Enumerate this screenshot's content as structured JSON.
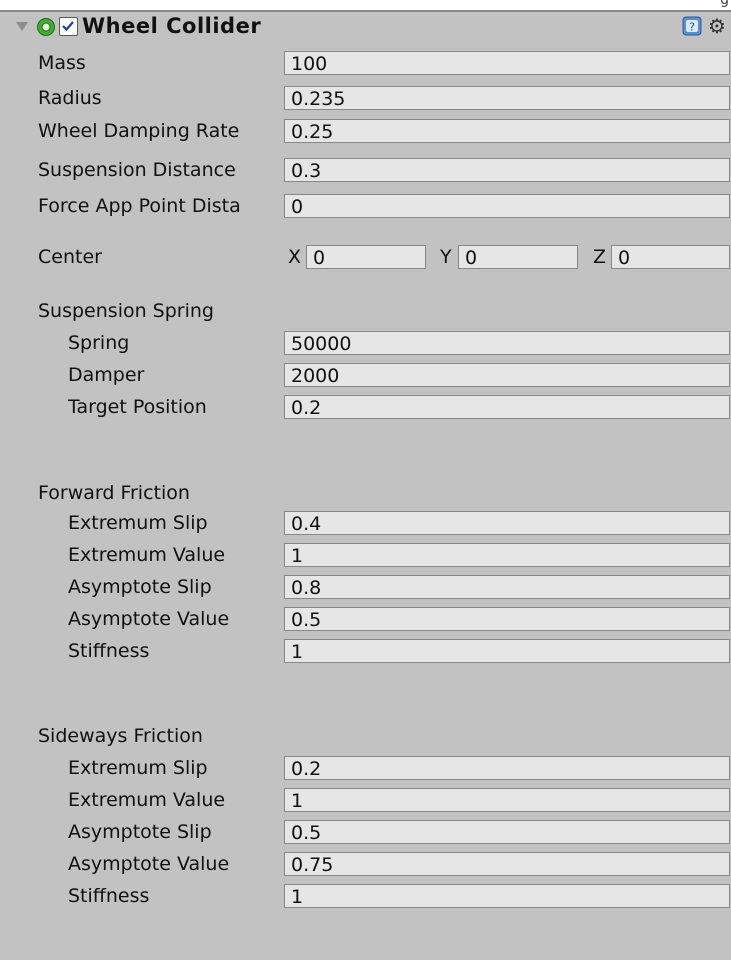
{
  "component": {
    "title": "Wheel Collider",
    "enabled": true,
    "icons": {
      "foldout": "triangle-down-icon",
      "component": "wheel-collider-icon",
      "help": "help-icon",
      "settings": "gear-icon"
    }
  },
  "properties": [
    {
      "label": "Mass",
      "value": "100"
    },
    {
      "label": "Radius",
      "value": "0.235"
    },
    {
      "label": "Wheel Damping Rate",
      "value": "0.25"
    },
    {
      "label": "Suspension Distance",
      "value": "0.3"
    },
    {
      "label": "Force App Point Dista",
      "value": "0"
    }
  ],
  "center": {
    "label": "Center",
    "x_label": "X",
    "x": "0",
    "y_label": "Y",
    "y": "0",
    "z_label": "Z",
    "z": "0"
  },
  "suspension_spring": {
    "label": "Suspension Spring",
    "fields": [
      {
        "label": "Spring",
        "value": "50000"
      },
      {
        "label": "Damper",
        "value": "2000"
      },
      {
        "label": "Target Position",
        "value": "0.2"
      }
    ]
  },
  "forward_friction": {
    "label": "Forward Friction",
    "fields": [
      {
        "label": "Extremum Slip",
        "value": "0.4"
      },
      {
        "label": "Extremum Value",
        "value": "1"
      },
      {
        "label": "Asymptote Slip",
        "value": "0.8"
      },
      {
        "label": "Asymptote Value",
        "value": "0.5"
      },
      {
        "label": "Stiffness",
        "value": "1"
      }
    ]
  },
  "sideways_friction": {
    "label": "Sideways Friction",
    "fields": [
      {
        "label": "Extremum Slip",
        "value": "0.2"
      },
      {
        "label": "Extremum Value",
        "value": "1"
      },
      {
        "label": "Asymptote Slip",
        "value": "0.5"
      },
      {
        "label": "Asymptote Value",
        "value": "0.75"
      },
      {
        "label": "Stiffness",
        "value": "1"
      }
    ]
  },
  "colors": {
    "panel": "#c2c2c2",
    "field": "#e6e6e6",
    "icon_green": "#3fae2f"
  }
}
